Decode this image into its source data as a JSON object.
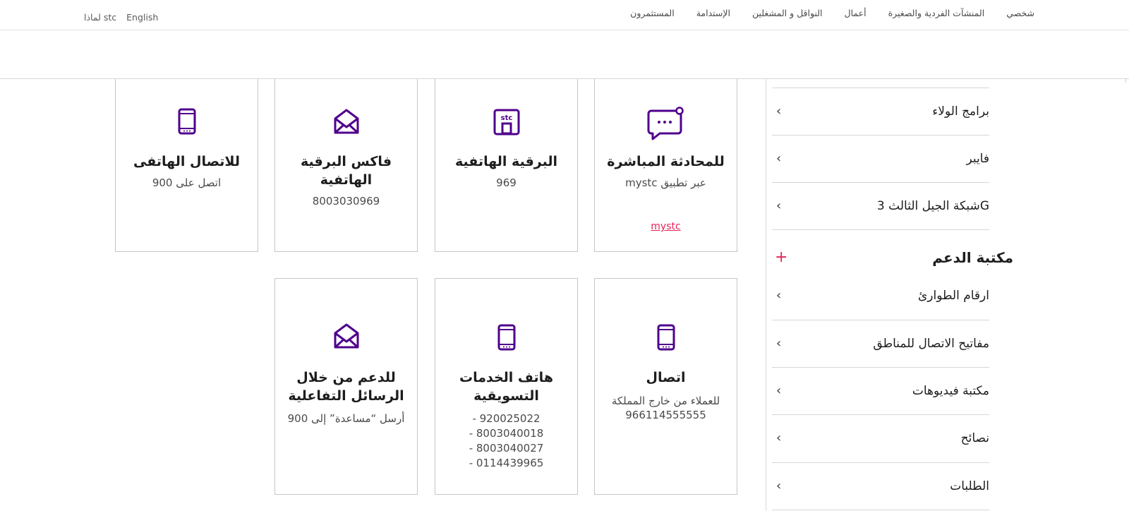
{
  "topbar": {
    "nav": [
      "شخصي",
      "المنشآت الفردية والصغيرة",
      "أعمال",
      "النواقل و المشغلين",
      "الإستدامة",
      "المستثمرون"
    ],
    "lang_english": "English",
    "lang_why": "لماذا stc"
  },
  "sidebar": {
    "items_top": [
      "برامج الولاء",
      "فايبر",
      "شبكة الجيل الثالث 3G"
    ],
    "section_title": "مكتبة الدعم",
    "items_bottom": [
      "ارقام الطوارئ",
      "مفاتيح الاتصال للمناطق",
      "مكتبة فيديوهات",
      "نصائح",
      "الطلبات"
    ]
  },
  "cards": {
    "c1": {
      "title": "للمحادثة المباشرة",
      "sub": "عبر تطبيق mystc",
      "link": "mystc",
      "icon": "chat-bubble-icon"
    },
    "c2": {
      "title": "البرقية الهاتفية",
      "sub": "969",
      "icon": "stc-store-icon"
    },
    "c3": {
      "title": "فاكس البرقية الهاتفية",
      "sub": "8003030969",
      "icon": "envelope-icon"
    },
    "c4": {
      "title": "للاتصال الهاتفى",
      "sub": "اتصل على 900",
      "icon": "mobile-phone-icon"
    },
    "c5": {
      "title": "اتصال",
      "sub": "للعملاء من خارج المملكة",
      "sub2": "966114555555",
      "icon": "mobile-phone-icon"
    },
    "c6": {
      "title": "هاتف الخدمات التسويقية",
      "lines": [
        "920025022 -",
        "8003040018 -",
        "8003040027 -",
        "0114439965 -"
      ],
      "icon": "mobile-phone-icon"
    },
    "c7": {
      "title": "للدعم من خلال الرسائل التفاعلية",
      "sub": "أرسل “مساعدة” إلى 900",
      "icon": "envelope-icon"
    }
  },
  "colors": {
    "purple": "#4f008c",
    "pink": "#e6245a"
  }
}
